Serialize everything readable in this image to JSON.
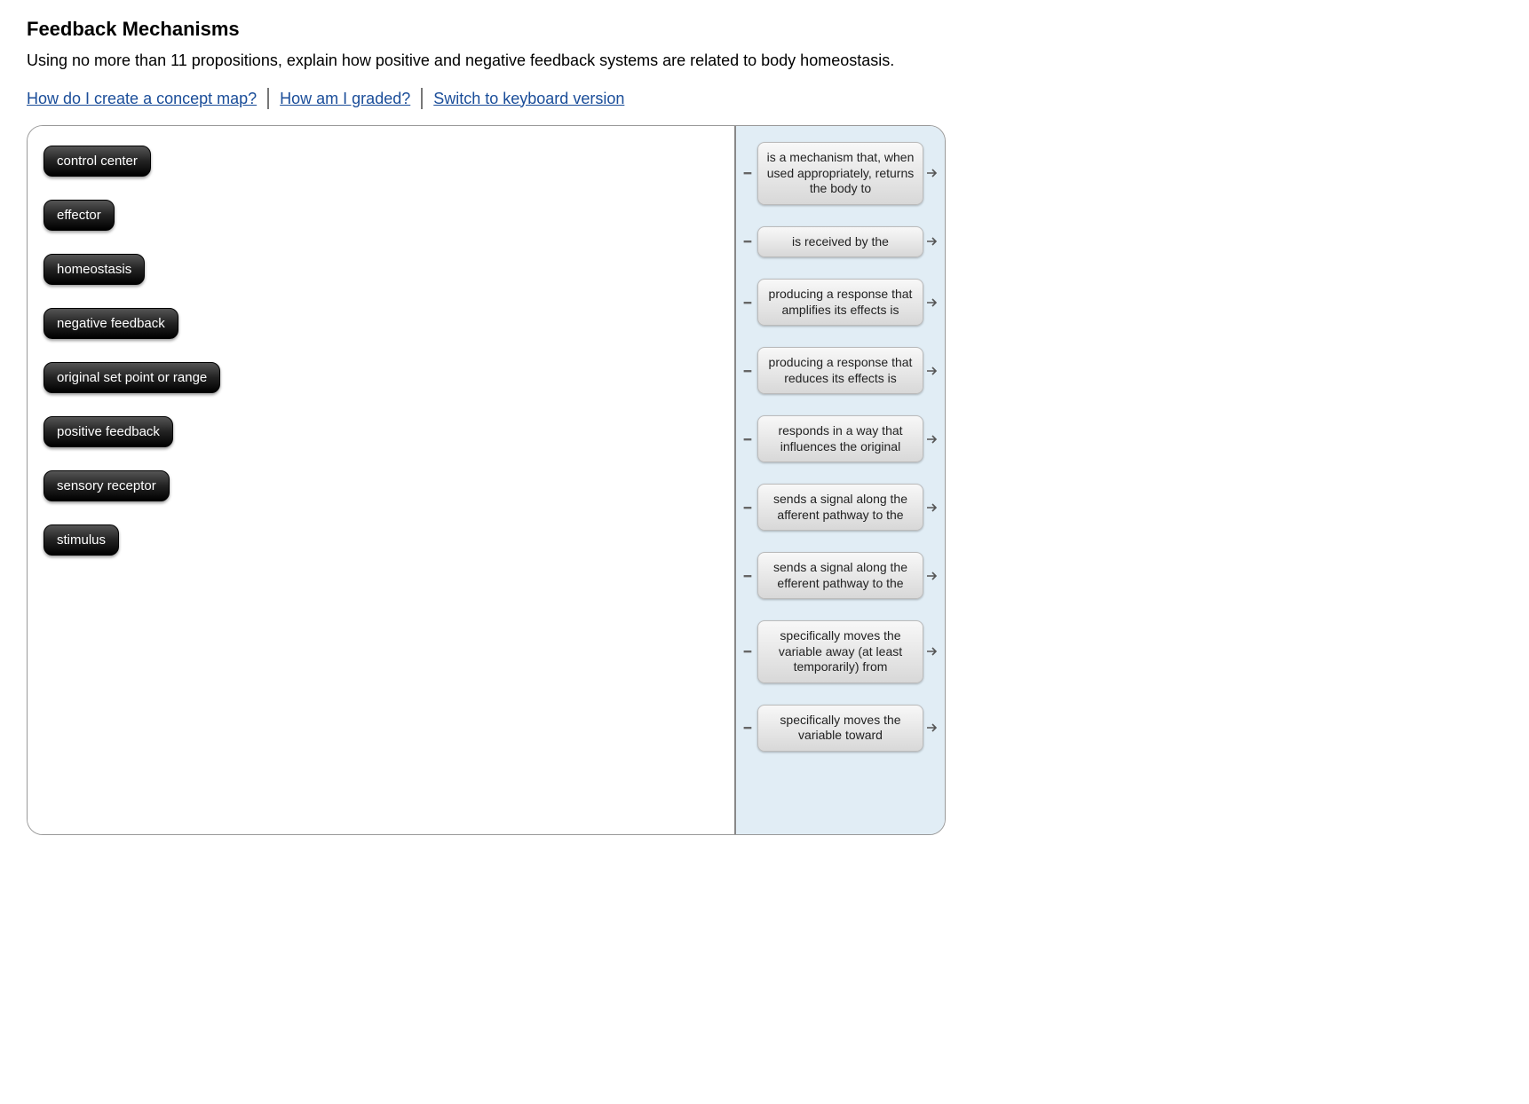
{
  "header": {
    "title": "Feedback Mechanisms",
    "subtitle": "Using no more than 11 propositions, explain how positive and negative feedback systems are related to body homeostasis."
  },
  "links": {
    "create_map": "How do I create a concept map?",
    "graded": "How am I graded?",
    "keyboard": "Switch to keyboard version"
  },
  "concepts": [
    "control center",
    "effector",
    "homeostasis",
    "negative feedback",
    "original set point or range",
    "positive feedback",
    "sensory receptor",
    "stimulus"
  ],
  "link_phrases": [
    "is a mechanism that, when used appropriately, returns the body to",
    "is received by the",
    "producing a response that amplifies its effects is",
    "producing a response that reduces its effects is",
    "responds in a way that influences the original",
    "sends a signal along the afferent pathway to the",
    "sends a signal along the efferent pathway to the",
    "specifically moves the variable away (at least temporarily) from",
    "specifically moves the variable toward"
  ]
}
